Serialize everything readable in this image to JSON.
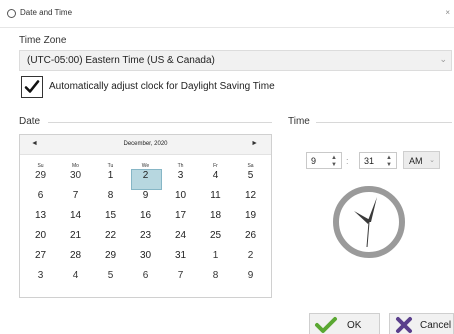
{
  "window": {
    "title": "Date and Time"
  },
  "timezone": {
    "label": "Time Zone",
    "selected": "(UTC-05:00) Eastern Time (US & Canada)"
  },
  "dst": {
    "label": "Automatically adjust clock for Daylight Saving Time",
    "checked": true
  },
  "date_section": {
    "label": "Date"
  },
  "time_section": {
    "label": "Time"
  },
  "calendar": {
    "month_year": "December, 2020",
    "prev_symbol": "◄",
    "next_symbol": "►",
    "weekdays": [
      "Su",
      "Mo",
      "Tu",
      "We",
      "Th",
      "Fr",
      "Sa"
    ],
    "weeks": [
      [
        "29",
        "30",
        "1",
        "2",
        "3",
        "4",
        "5"
      ],
      [
        "6",
        "7",
        "8",
        "9",
        "10",
        "11",
        "12"
      ],
      [
        "13",
        "14",
        "15",
        "16",
        "17",
        "18",
        "19"
      ],
      [
        "20",
        "21",
        "22",
        "23",
        "24",
        "25",
        "26"
      ],
      [
        "27",
        "28",
        "29",
        "30",
        "31",
        "1",
        "2"
      ],
      [
        "3",
        "4",
        "5",
        "6",
        "7",
        "8",
        "9"
      ]
    ],
    "selected_day": "2",
    "selection_color": "#b7d7e0"
  },
  "time": {
    "hour": "9",
    "minute": "31",
    "separator": ":",
    "ampm": "AM"
  },
  "buttons": {
    "ok_label": "OK",
    "cancel_label": "Cancel"
  },
  "colors": {
    "ok_check": "#5aa832",
    "cancel_x": "#5a3f8c",
    "clock_ring": "#9a9a9a",
    "clock_hands": "#3a3a3a"
  }
}
